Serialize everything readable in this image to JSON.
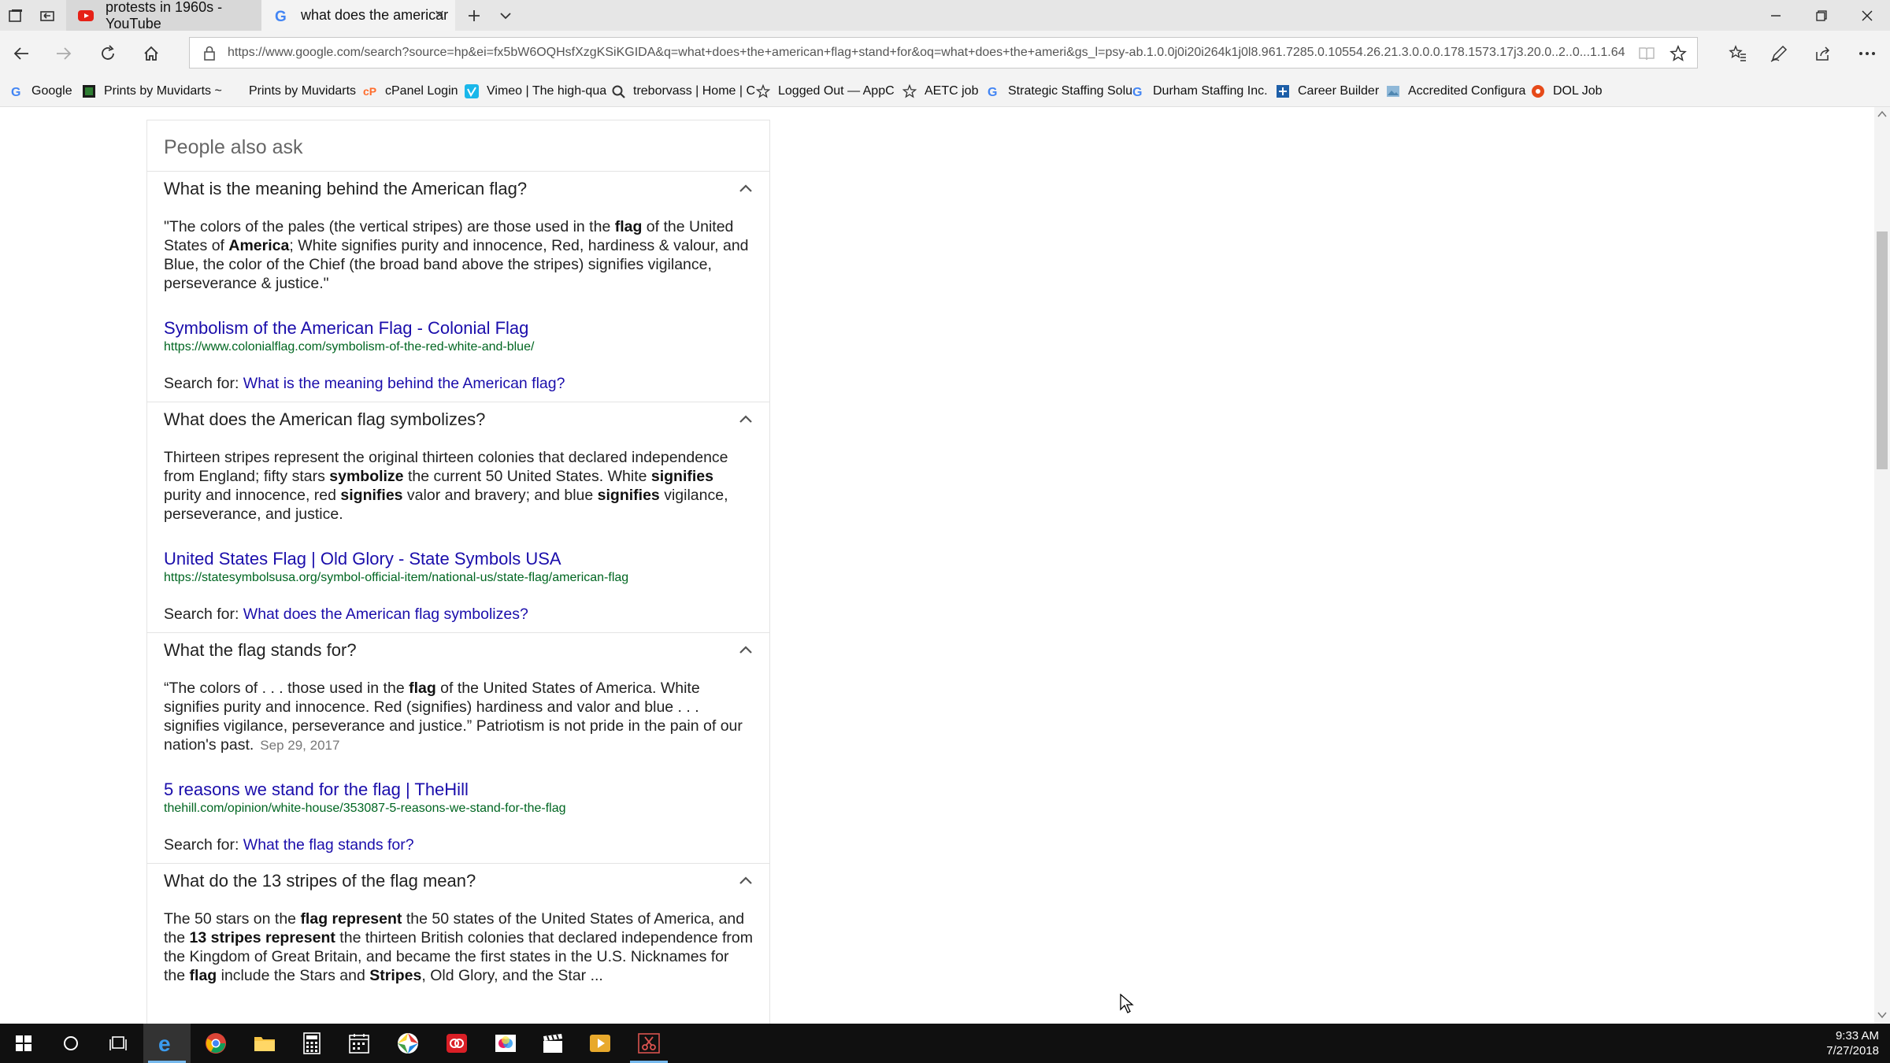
{
  "browser": {
    "tabs": [
      {
        "title": "protests in 1960s - YouTube",
        "icon": "youtube-icon",
        "active": false
      },
      {
        "title": "what does the americar",
        "icon": "google-icon",
        "active": true
      }
    ],
    "address_url": "https://www.google.com/search?source=hp&ei=fx5bW6OQHsfXzgKSiKGIDA&q=what+does+the+american+flag+stand+for&oq=what+does+the+ameri&gs_l=psy-ab.1.0.0j0i20i264k1j0l8.961.7285.0.10554.26.21.3.0.0.0.178.1573.17j3.20.0..2..0...1.1.64"
  },
  "favorites": [
    {
      "label": "Google",
      "icon": "google-icon",
      "color": "#4285f4"
    },
    {
      "label": "Prints by Muvidarts ~",
      "icon": "muvidarts-icon",
      "color": "#2e7d32"
    },
    {
      "label": "Prints by Muvidarts",
      "icon": "none",
      "color": "#ffffff"
    },
    {
      "label": "cPanel Login",
      "icon": "cpanel-icon",
      "color": "#ff6c2c"
    },
    {
      "label": "Vimeo | The high-qua",
      "icon": "vimeo-icon",
      "color": "#1ab7ea"
    },
    {
      "label": "treborvass | Home | C",
      "icon": "search-icon",
      "color": "#333333"
    },
    {
      "label": "Logged Out — AppC",
      "icon": "star-icon",
      "color": "#333333"
    },
    {
      "label": "AETC job",
      "icon": "star-icon",
      "color": "#333333"
    },
    {
      "label": "Strategic Staffing Solu",
      "icon": "google-icon",
      "color": "#4285f4"
    },
    {
      "label": "Durham Staffing Inc.",
      "icon": "google-icon",
      "color": "#4285f4"
    },
    {
      "label": "Career Builder",
      "icon": "careerbuilder-icon",
      "color": "#1e5fa8"
    },
    {
      "label": "Accredited Configura",
      "icon": "image-icon",
      "color": "#8fb8d8"
    },
    {
      "label": "DOL Job",
      "icon": "dol-icon",
      "color": "#e64a19"
    }
  ],
  "paa": {
    "title": "People also ask",
    "questions": [
      {
        "question": "What is the meaning behind the American flag?",
        "answer_html": "\"The colors of the pales (the vertical stripes) are those used in the <b>flag</b> of the United States of <b>America</b>; White signifies purity and innocence, Red, hardiness &amp; valour, and Blue, the color of the Chief (the broad band above the stripes) signifies vigilance, perseverance &amp; justice.\"",
        "date": "",
        "link_title": "Symbolism of the American Flag - Colonial Flag",
        "link_url": "https://www.colonialflag.com/symbolism-of-the-red-white-and-blue/",
        "search_prefix": "Search for: ",
        "search_text": "What is the meaning behind the American flag?"
      },
      {
        "question": "What does the American flag symbolizes?",
        "answer_html": "Thirteen stripes represent the original thirteen colonies that declared independence from England; fifty stars <b>symbolize</b> the current 50 United States. White <b>signifies</b> purity and innocence, red <b>signifies</b> valor and bravery; and blue <b>signifies</b> vigilance, perseverance, and justice.",
        "date": "",
        "link_title": "United States Flag | Old Glory - State Symbols USA",
        "link_url": "https://statesymbolsusa.org/symbol-official-item/national-us/state-flag/american-flag",
        "search_prefix": "Search for: ",
        "search_text": "What does the American flag symbolizes?"
      },
      {
        "question": "What the flag stands for?",
        "answer_html": "“The colors of . . . those used in the <b>flag</b> of the United States of America. White signifies purity and innocence. Red (signifies) hardiness and valor and blue . . . signifies vigilance, perseverance and justice.” Patriotism is not pride in the pain of our nation's past.",
        "date": "Sep 29, 2017",
        "link_title": "5 reasons we stand for the flag | TheHill",
        "link_url": "thehill.com/opinion/white-house/353087-5-reasons-we-stand-for-the-flag",
        "search_prefix": "Search for: ",
        "search_text": "What the flag stands for?"
      },
      {
        "question": "What do the 13 stripes of the flag mean?",
        "answer_html": "The 50 stars on the <b>flag represent</b> the 50 states of the United States of America, and the <b>13 stripes represent</b> the thirteen British colonies that declared independence from the Kingdom of Great Britain, and became the first states in the U.S. Nicknames for the <b>flag</b> include the Stars and <b>Stripes</b>, Old Glory, and the Star ...",
        "date": "",
        "link_title": "",
        "link_url": "",
        "search_prefix": "",
        "search_text": ""
      }
    ]
  },
  "taskbar": {
    "apps": [
      {
        "name": "start-button",
        "icon": "windows-icon"
      },
      {
        "name": "cortana-button",
        "icon": "cortana-icon"
      },
      {
        "name": "task-view-button",
        "icon": "task-view-icon"
      },
      {
        "name": "edge-app",
        "icon": "edge-icon",
        "active": true
      },
      {
        "name": "chrome-app",
        "icon": "chrome-icon"
      },
      {
        "name": "file-explorer-app",
        "icon": "folder-icon"
      },
      {
        "name": "calculator-app",
        "icon": "calculator-icon"
      },
      {
        "name": "calendar-app",
        "icon": "calendar-icon"
      },
      {
        "name": "photos-app",
        "icon": "aperture-icon"
      },
      {
        "name": "creative-cloud-app",
        "icon": "adobe-icon"
      },
      {
        "name": "photo-editor-app",
        "icon": "photo-icon"
      },
      {
        "name": "video-app",
        "icon": "clapper-icon"
      },
      {
        "name": "media-player-app",
        "icon": "play-icon"
      },
      {
        "name": "snipping-app",
        "icon": "scissors-icon",
        "active": true
      }
    ],
    "time": "9:33 AM",
    "date": "7/27/2018"
  }
}
